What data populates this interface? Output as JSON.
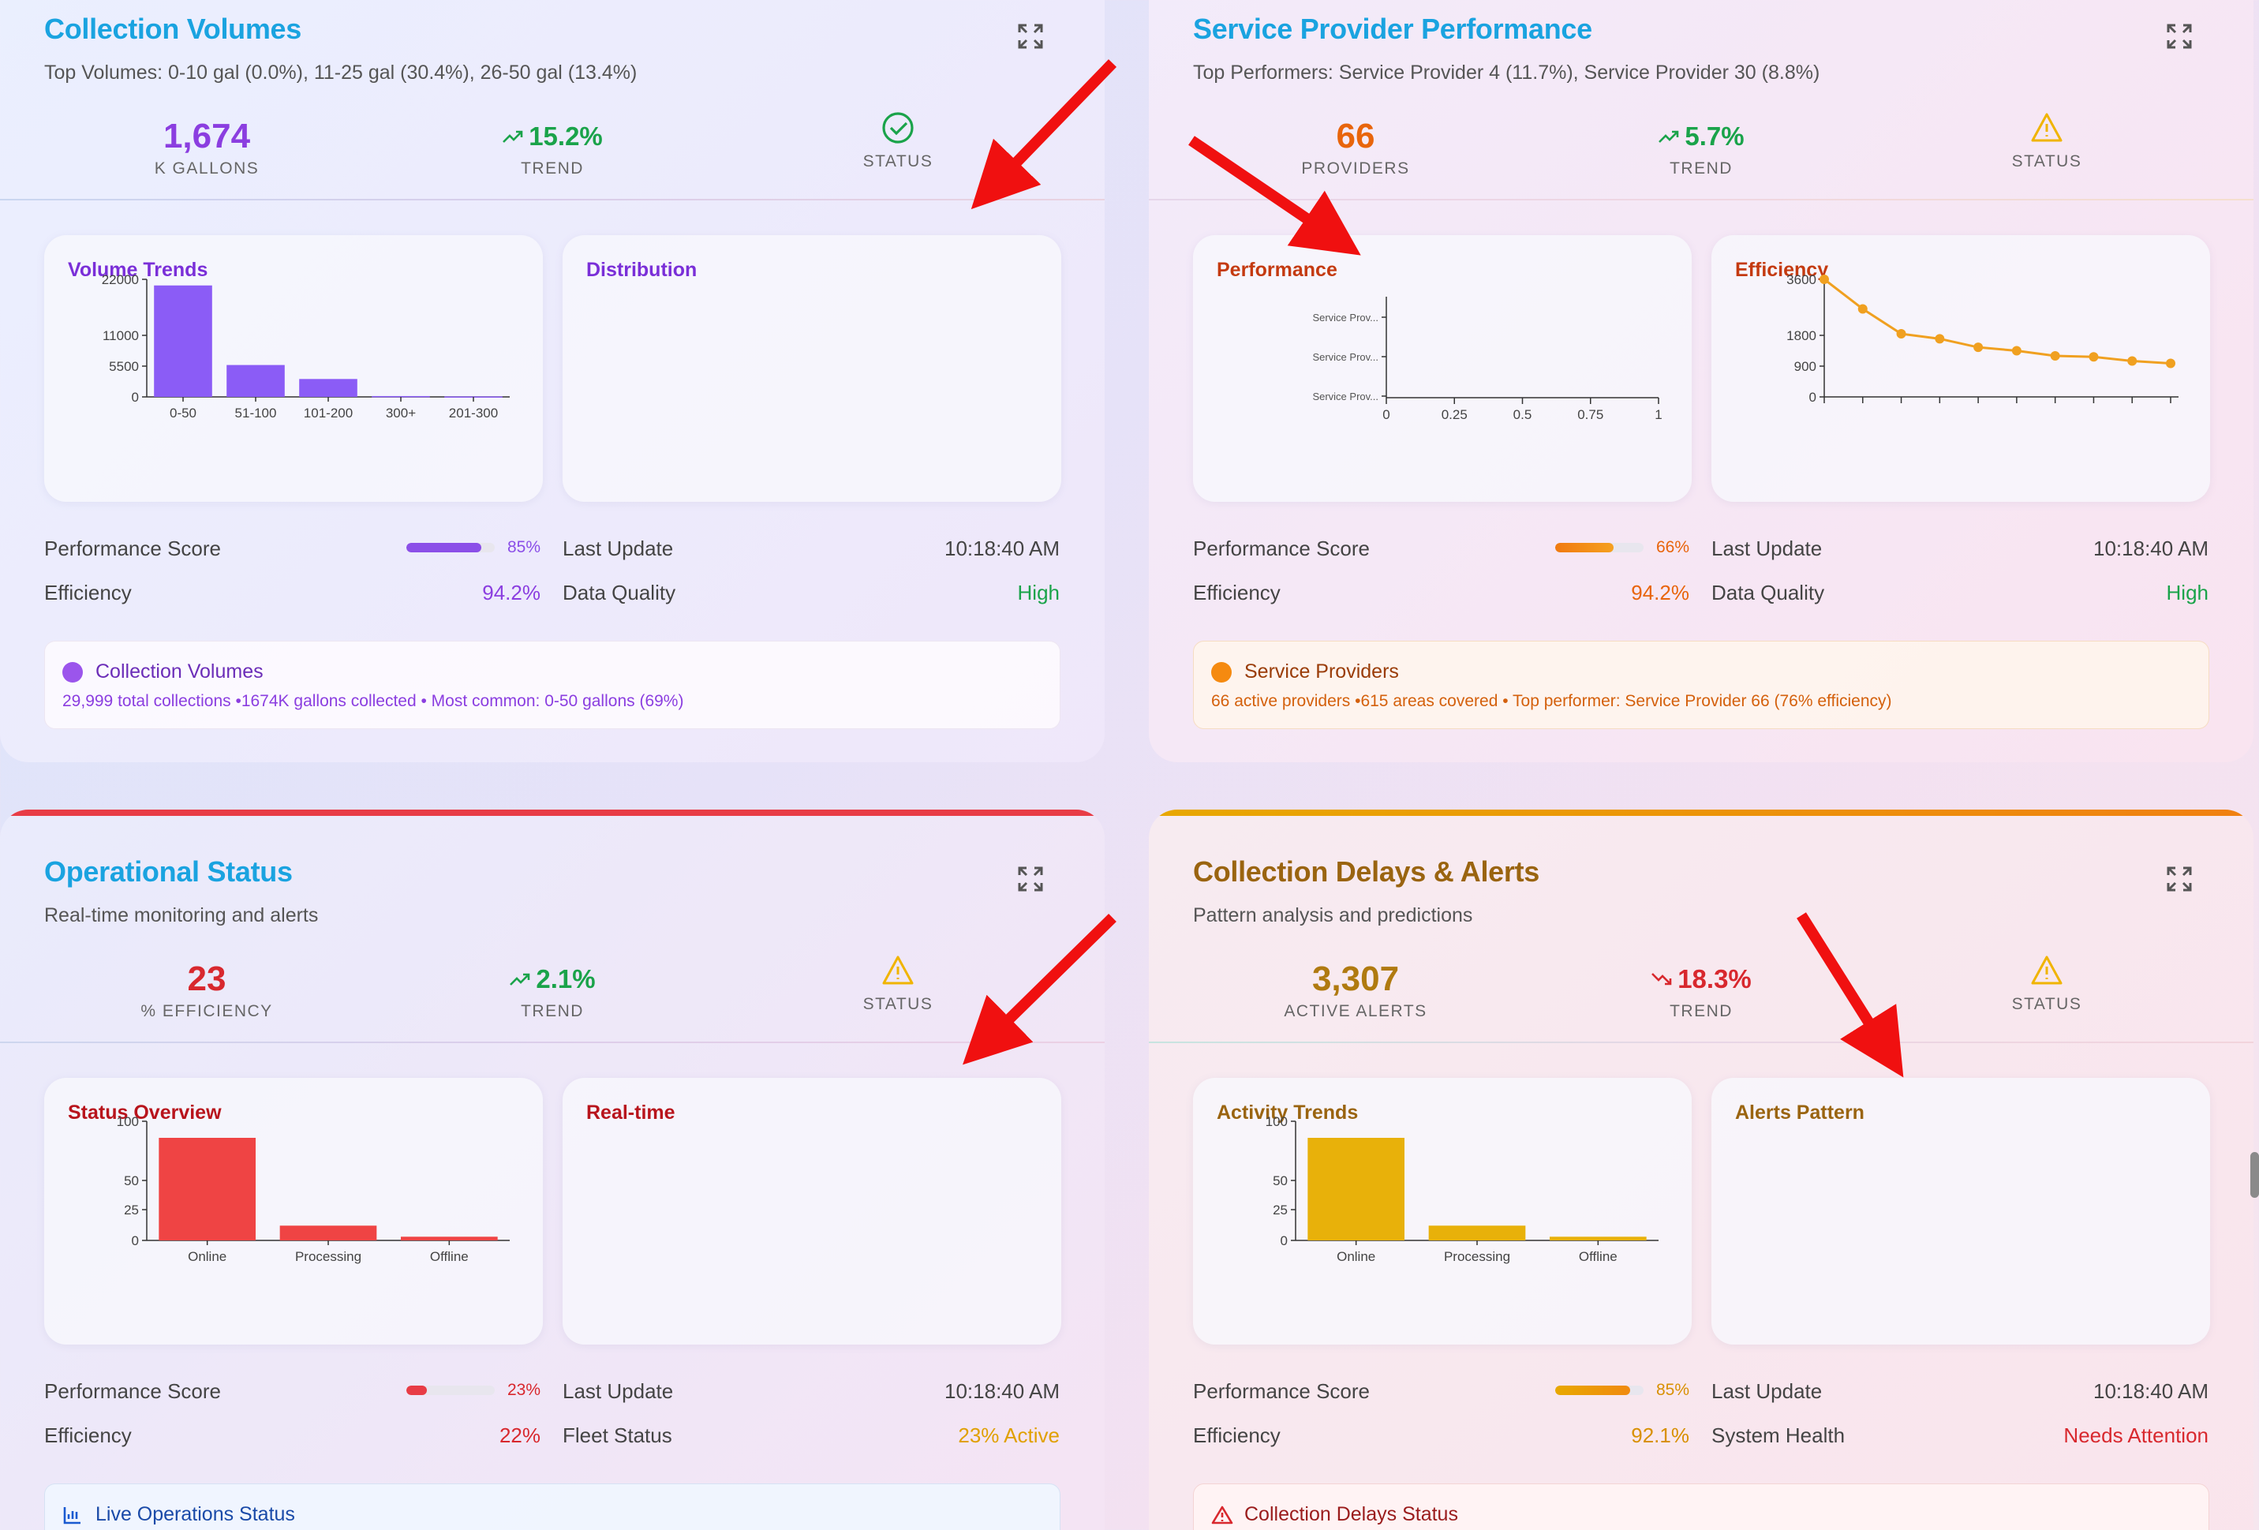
{
  "cards": [
    {
      "title": "Collection Volumes",
      "subtitle": "Top Volumes: 0-10 gal (0.0%), 11-25 gal (30.4%), 26-50 gal (13.4%)",
      "metric_value": "1,674",
      "metric_label": "K GALLONS",
      "trend_value": "15.2%",
      "trend_label": "TREND",
      "status_label": "STATUS",
      "panel_left_title": "Volume Trends",
      "panel_right_title": "Distribution",
      "row1_label": "Performance Score",
      "row1_pct": "85%",
      "row1_fill": 0.85,
      "row2_label": "Efficiency",
      "row2_value": "94.2%",
      "row3_label": "Last Update",
      "row3_value": "10:18:40 AM",
      "row4_label": "Data Quality",
      "row4_value": "High",
      "info_title": "Collection Volumes",
      "info_desc": "29,999 total collections •1674K gallons collected • Most common: 0-50 gallons (69%)"
    },
    {
      "title": "Service Provider Performance",
      "subtitle": "Top Performers: Service Provider 4 (11.7%), Service Provider 30 (8.8%)",
      "metric_value": "66",
      "metric_label": "PROVIDERS",
      "trend_value": "5.7%",
      "trend_label": "TREND",
      "status_label": "STATUS",
      "panel_left_title": "Performance",
      "panel_right_title": "Efficiency",
      "row1_label": "Performance Score",
      "row1_pct": "66%",
      "row1_fill": 0.66,
      "row2_label": "Efficiency",
      "row2_value": "94.2%",
      "row3_label": "Last Update",
      "row3_value": "10:18:40 AM",
      "row4_label": "Data Quality",
      "row4_value": "High",
      "info_title": "Service Providers",
      "info_desc": "66 active providers •615 areas covered • Top performer: Service Provider 66 (76% efficiency)"
    },
    {
      "title": "Operational Status",
      "subtitle": "Real-time monitoring and alerts",
      "metric_value": "23",
      "metric_label": "% EFFICIENCY",
      "trend_value": "2.1%",
      "trend_label": "TREND",
      "status_label": "STATUS",
      "panel_left_title": "Status Overview",
      "panel_right_title": "Real-time",
      "row1_label": "Performance Score",
      "row1_pct": "23%",
      "row1_fill": 0.23,
      "row2_label": "Efficiency",
      "row2_value": "22%",
      "row3_label": "Last Update",
      "row3_value": "10:18:40 AM",
      "row4_label": "Fleet Status",
      "row4_value": "23% Active",
      "info_title": "Live Operations Status"
    },
    {
      "title": "Collection Delays & Alerts",
      "subtitle": "Pattern analysis and predictions",
      "metric_value": "3,307",
      "metric_label": "ACTIVE ALERTS",
      "trend_value": "18.3%",
      "trend_label": "TREND",
      "status_label": "STATUS",
      "panel_left_title": "Activity Trends",
      "panel_right_title": "Alerts Pattern",
      "row1_label": "Performance Score",
      "row1_pct": "85%",
      "row1_fill": 0.85,
      "row2_label": "Efficiency",
      "row2_value": "92.1%",
      "row3_label": "Last Update",
      "row3_value": "10:18:40 AM",
      "row4_label": "System Health",
      "row4_value": "Needs Attention",
      "info_title": "Collection Delays Status"
    }
  ],
  "colors": {
    "blue_title": "#1aa3e0",
    "purple": "#8b4fe8",
    "orange": "#f08a1c",
    "red": "#e83c46",
    "gold": "#e0b000",
    "green": "#1aa34a",
    "brown_title": "#a06810"
  },
  "chart_data": [
    {
      "type": "bar",
      "title": "Volume Trends",
      "categories": [
        "0-50",
        "51-100",
        "101-200",
        "300+",
        "201-300"
      ],
      "values": [
        20800,
        5700,
        3200,
        150,
        80
      ],
      "yticks": [
        "22000",
        "11000",
        "5500",
        "0"
      ],
      "ylim": [
        0,
        22000
      ],
      "scale": "custom"
    },
    {
      "type": "bar",
      "orientation": "horizontal",
      "title": "Performance",
      "categories": [
        "Service Prov...",
        "Service Prov...",
        "Service Prov..."
      ],
      "values": [
        0,
        0,
        0
      ],
      "xticks": [
        "0",
        "0.25",
        "0.5",
        "0.75",
        "1"
      ],
      "xlim": [
        0,
        1
      ]
    },
    {
      "type": "line",
      "title": "Efficiency",
      "x": [
        1,
        2,
        3,
        4,
        5,
        6,
        7,
        8,
        9,
        10
      ],
      "values": [
        3600,
        2650,
        1850,
        1700,
        1450,
        1350,
        1200,
        1170,
        1050,
        980
      ],
      "yticks": [
        "3600",
        "1800",
        "900",
        "0"
      ],
      "ylim": [
        0,
        3600
      ]
    },
    {
      "type": "bar",
      "title": "Status Overview",
      "categories": [
        "Online",
        "Processing",
        "Offline"
      ],
      "values": [
        86,
        12,
        3
      ],
      "yticks": [
        "100",
        "50",
        "25",
        "0"
      ],
      "ylim": [
        0,
        100
      ]
    },
    {
      "type": "bar",
      "title": "Activity Trends",
      "categories": [
        "Online",
        "Processing",
        "Offline"
      ],
      "values": [
        86,
        12,
        3
      ],
      "yticks": [
        "100",
        "50",
        "25",
        "0"
      ],
      "ylim": [
        0,
        100
      ]
    }
  ]
}
